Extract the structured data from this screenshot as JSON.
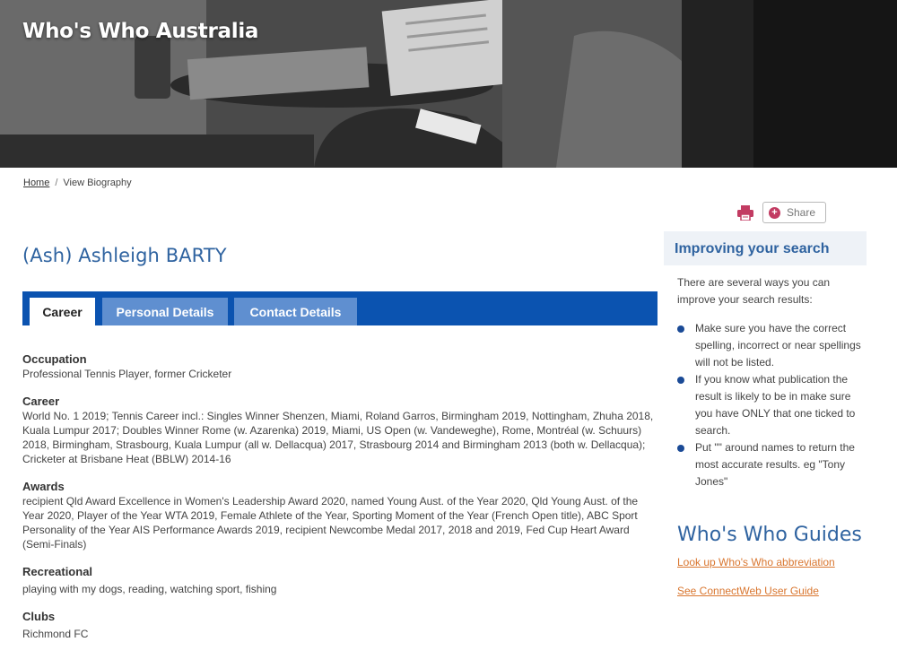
{
  "header": {
    "site_title": "Who's Who Australia"
  },
  "breadcrumb": {
    "home": "Home",
    "separator": "/",
    "current": "View Biography"
  },
  "actions": {
    "share_label": "Share",
    "print_icon": "printer-icon",
    "share_icon": "plus-circle-icon"
  },
  "person": {
    "name": "(Ash) Ashleigh BARTY"
  },
  "tabs": [
    {
      "label": "Career",
      "active": true
    },
    {
      "label": "Personal Details",
      "active": false
    },
    {
      "label": "Contact Details",
      "active": false
    }
  ],
  "sections": {
    "occupation": {
      "heading": "Occupation",
      "text": "Professional Tennis Player, former Cricketer"
    },
    "career": {
      "heading": "Career",
      "text": "World No. 1 2019; Tennis Career incl.: Singles Winner Shenzen, Miami, Roland Garros, Birmingham 2019, Nottingham, Zhuha 2018, Kuala Lumpur 2017; Doubles Winner Rome (w. Azarenka) 2019, Miami, US Open (w. Vandeweghe), Rome, Montréal (w. Schuurs) 2018, Birmingham, Strasbourg, Kuala Lumpur (all w. Dellacqua) 2017, Strasbourg 2014 and Birmingham 2013 (both w. Dellacqua); Cricketer at Brisbane Heat (BBLW) 2014-16"
    },
    "awards": {
      "heading": "Awards",
      "text": "recipient Qld Award Excellence in Women's Leadership Award 2020, named Young Aust. of the Year 2020, Qld Young Aust. of the Year 2020, Player of the Year WTA 2019, Female Athlete of the Year, Sporting Moment of the Year (French Open title), ABC Sport Personality of the Year AIS Performance Awards 2019, recipient Newcombe Medal 2017, 2018 and 2019, Fed Cup Heart Award (Semi-Finals)"
    },
    "recreational": {
      "heading": "Recreational",
      "text": "playing with my dogs, reading, watching sport, fishing"
    },
    "clubs": {
      "heading": "Clubs",
      "text": "Richmond FC"
    }
  },
  "sidebar": {
    "heading": "Improving your search",
    "intro": "There are several ways you can improve your search results:",
    "tips": [
      "Make sure you have the correct spelling, incorrect or near spellings will not be listed.",
      "If you know what publication the result is likely to be in make sure you have ONLY that one ticked to search.",
      "Put \"\" around names to return the most accurate results. eg \"Tony Jones\""
    ]
  },
  "guides": {
    "title": "Who's Who Guides",
    "links": [
      "Look up Who's Who abbreviation",
      "See ConnectWeb User Guide"
    ]
  },
  "colors": {
    "tab_bar": "#0b53b0",
    "tab_inactive": "#5f8fd0",
    "heading_blue": "#2f63a0",
    "link_orange": "#d9762f",
    "share_accent": "#c23b62"
  }
}
